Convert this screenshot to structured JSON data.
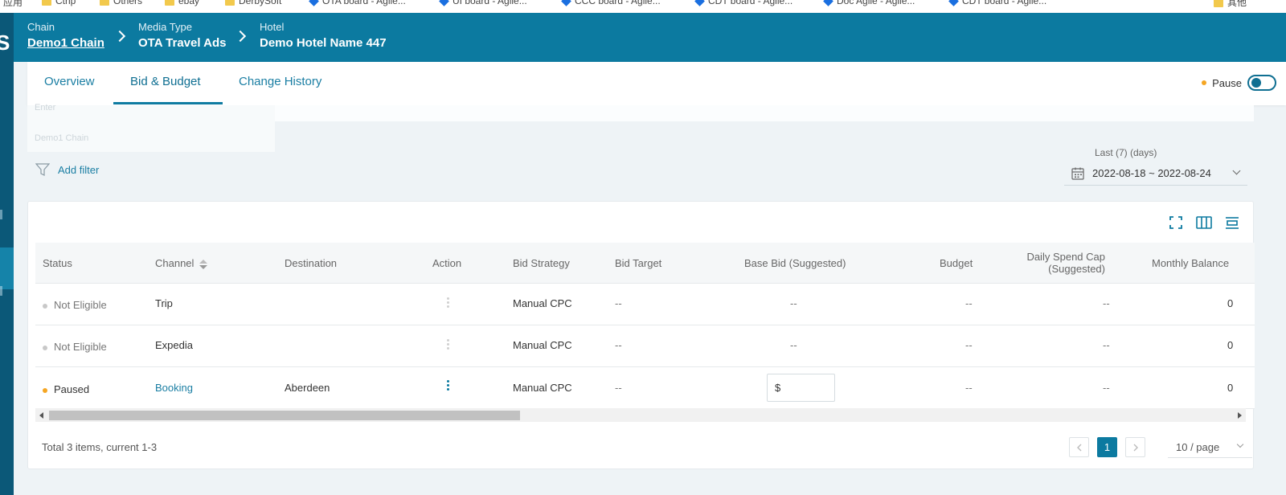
{
  "bookmarks": [
    "应用",
    "Ctrip",
    "Others",
    "ebay",
    "DerbySoft",
    "OTA board - Agile...",
    "UI board - Agile...",
    "CCC board - Agile...",
    "CDT board - Agile...",
    "Doc Agile - Agile...",
    "CDT board - Agile...",
    "其他"
  ],
  "header": {
    "crumbs": [
      {
        "label": "Chain",
        "value": "Demo1 Chain"
      },
      {
        "label": "Media Type",
        "value": "OTA Travel Ads"
      },
      {
        "label": "Hotel",
        "value": "Demo Hotel Name 447"
      }
    ]
  },
  "tabs": [
    "Overview",
    "Bid & Budget",
    "Change History"
  ],
  "active_tab": "Bid & Budget",
  "pause": {
    "label": "Pause",
    "dot_color": "#f5a623"
  },
  "ghost": {
    "top": "Enter",
    "bottom": "Demo1 Chain"
  },
  "filter": {
    "add_label": "Add filter"
  },
  "date": {
    "label": "Last (7) (days)",
    "range": "2022-08-18 ~ 2022-08-24"
  },
  "table": {
    "columns": {
      "status": "Status",
      "channel": "Channel",
      "destination": "Destination",
      "action": "Action",
      "bid_strategy": "Bid Strategy",
      "bid_target": "Bid Target",
      "base_bid": "Base Bid (Suggested)",
      "budget": "Budget",
      "daily_cap_1": "Daily Spend Cap",
      "daily_cap_2": "(Suggested)",
      "monthly_balance": "Monthly Balance"
    },
    "rows": [
      {
        "status": "Not Eligible",
        "status_color": "#c8c8c8",
        "channel": "Trip",
        "destination": "",
        "bid_strategy": "Manual CPC",
        "bid_target": "--",
        "base_bid": "--",
        "budget": "--",
        "daily_cap": "--",
        "monthly_balance": "0"
      },
      {
        "status": "Not Eligible",
        "status_color": "#c8c8c8",
        "channel": "Expedia",
        "destination": "",
        "bid_strategy": "Manual CPC",
        "bid_target": "--",
        "base_bid": "--",
        "budget": "--",
        "daily_cap": "--",
        "monthly_balance": "0"
      },
      {
        "status": "Paused",
        "status_color": "#f5a623",
        "channel": "Booking",
        "destination": "Aberdeen",
        "bid_strategy": "Manual CPC",
        "bid_target": "--",
        "base_bid_input": "$",
        "budget": "--",
        "daily_cap": "--",
        "monthly_balance": "0"
      }
    ]
  },
  "pagination": {
    "total_text": "Total 3 items, current 1-3",
    "current_page": "1",
    "page_size": "10 / page"
  },
  "colors": {
    "brand": "#0c7aa0",
    "brand_dark": "#0b5878",
    "link": "#1a7ea3"
  }
}
